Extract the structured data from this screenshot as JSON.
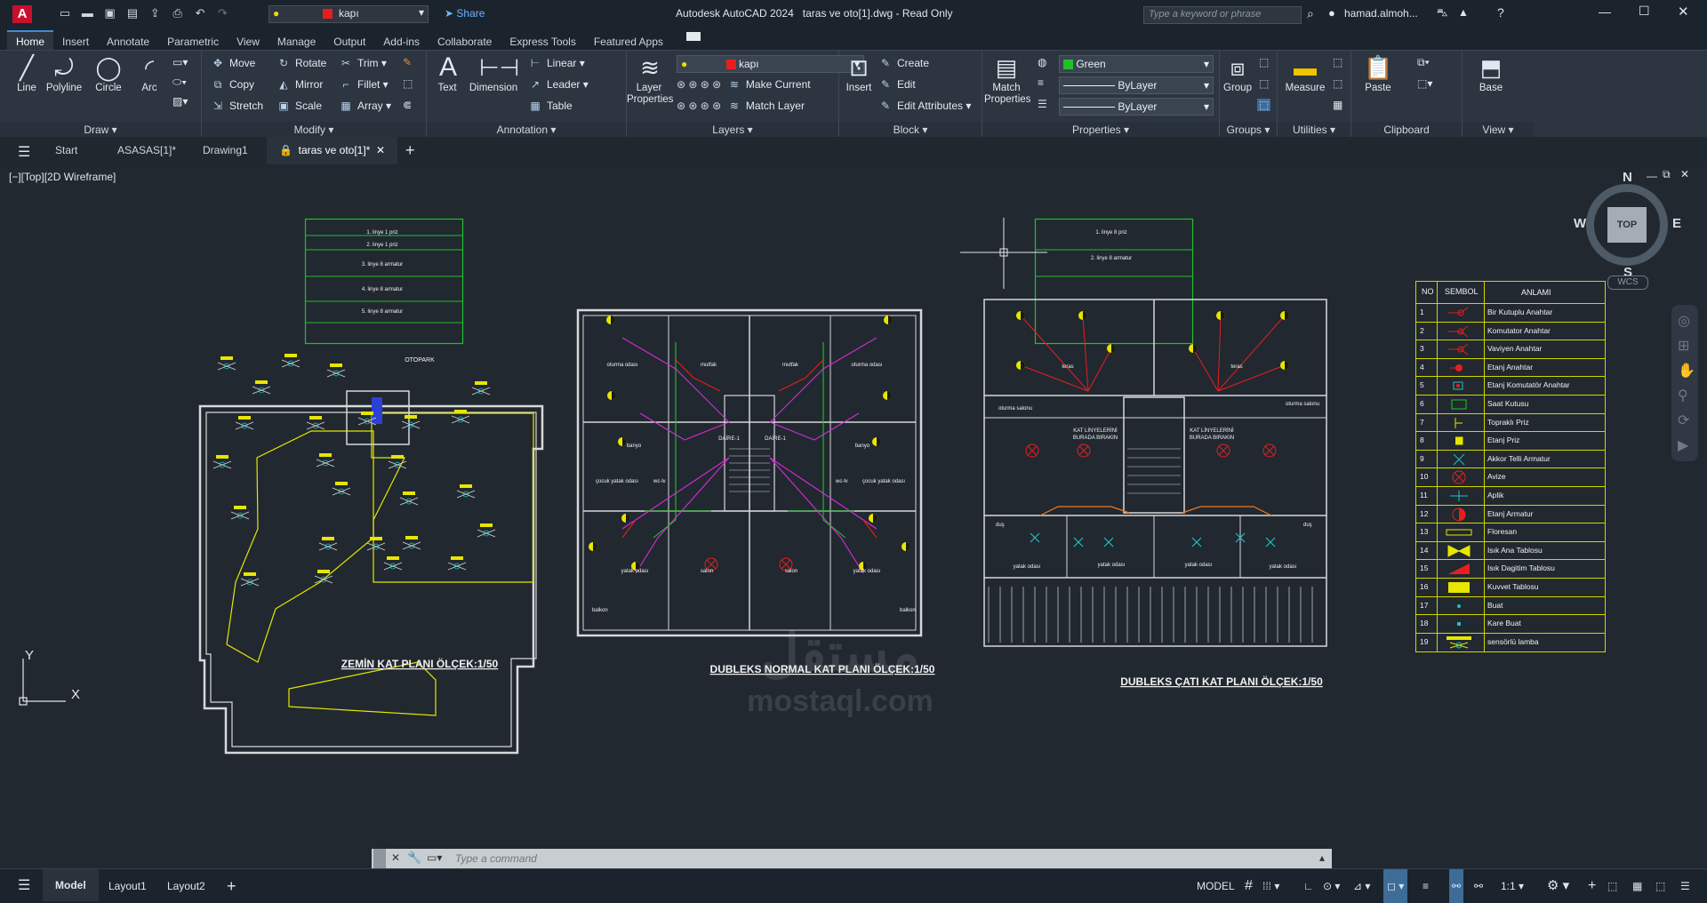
{
  "app": {
    "title": "Autodesk AutoCAD 2024",
    "file": "taras ve oto[1].dwg - Read Only",
    "share": "Share",
    "search_placeholder": "Type a keyword or phrase",
    "user": "hamad.almoh...",
    "layer_combo": "kapı"
  },
  "ribbon_tabs": [
    "Home",
    "Insert",
    "Annotate",
    "Parametric",
    "View",
    "Manage",
    "Output",
    "Add-ins",
    "Collaborate",
    "Express Tools",
    "Featured Apps"
  ],
  "ribbon": {
    "draw": {
      "title": "Draw",
      "line": "Line",
      "polyline": "Polyline",
      "circle": "Circle",
      "arc": "Arc"
    },
    "modify": {
      "title": "Modify",
      "move": "Move",
      "rotate": "Rotate",
      "trim": "Trim",
      "copy": "Copy",
      "mirror": "Mirror",
      "fillet": "Fillet",
      "stretch": "Stretch",
      "scale": "Scale",
      "array": "Array"
    },
    "annotation": {
      "title": "Annotation",
      "text": "Text",
      "dimension": "Dimension",
      "linear": "Linear",
      "leader": "Leader",
      "table": "Table"
    },
    "layers": {
      "title": "Layers",
      "layer_properties": "Layer Properties",
      "current_layer": "kapı",
      "make_current": "Make Current",
      "match_layer": "Match Layer"
    },
    "block": {
      "title": "Block",
      "insert": "Insert",
      "create": "Create",
      "edit": "Edit",
      "edit_attributes": "Edit Attributes"
    },
    "properties": {
      "title": "Properties",
      "match_properties": "Match Properties",
      "color": "Green",
      "linetype": "ByLayer",
      "lineweight": "ByLayer"
    },
    "groups": {
      "title": "Groups",
      "group": "Group"
    },
    "utilities": {
      "title": "Utilities",
      "measure": "Measure"
    },
    "clipboard": {
      "title": "Clipboard",
      "paste": "Paste"
    },
    "view": {
      "title": "View",
      "base": "Base"
    }
  },
  "doc_tabs": [
    "Start",
    "ASASAS[1]*",
    "Drawing1",
    "taras ve oto[1]*"
  ],
  "viewport_label": "[−][Top][2D Wireframe]",
  "viewcube": {
    "n": "N",
    "s": "S",
    "e": "E",
    "w": "W",
    "top": "TOP",
    "wcs": "WCS"
  },
  "ucs": {
    "x": "X",
    "y": "Y"
  },
  "command_placeholder": "Type a command",
  "status": {
    "layout_tabs": [
      "Model",
      "Layout1",
      "Layout2"
    ],
    "model": "MODEL",
    "scale": "1:1"
  },
  "drawing": {
    "note_table_1": [
      "1. linye 1 priz",
      "2. linye 1 priz",
      "3. linye 8 armatur",
      "4. linye 8 armatur",
      "5. linye 8 armatur"
    ],
    "note_table_2": [
      "1. linye 8 priz",
      "2. linye 8 armatur"
    ],
    "plan1_title": "ZEMİN KAT PLANI ÖLÇEK:1/50",
    "plan2_title": "DUBLEKS NORMAL KAT PLANI ÖLÇEK:1/50",
    "plan3_title": "DUBLEKS ÇATI KAT PLANI ÖLÇEK:1/50",
    "otopark": "OTOPARK",
    "room_labels": {
      "oturma": "oturma odası",
      "mutfak": "mutfak",
      "banyo": "banyo",
      "cocuk": "çocuk yatak odası",
      "yatak": "yatak odası",
      "salon": "salon",
      "balkon": "balkon",
      "daire1": "DAİRE-1",
      "wc": "wc-lv",
      "teras": "teras",
      "oturma_salonu": "oturma salonu",
      "kat_note_1": "KAT LİNYELERİNİ",
      "kat_note_2": "BURADA BIRAKIN",
      "dus": "duş"
    },
    "legend": {
      "headers": [
        "NO",
        "SEMBOL",
        "ANLAMI"
      ],
      "rows": [
        {
          "no": "1",
          "label": "Bir Kutuplu Anahtar",
          "sym": "switch"
        },
        {
          "no": "2",
          "label": "Komutator Anahtar",
          "sym": "switch2"
        },
        {
          "no": "3",
          "label": "Vaviyen Anahtar",
          "sym": "switch2"
        },
        {
          "no": "4",
          "label": "Etanj Anahtar",
          "sym": "switch3"
        },
        {
          "no": "5",
          "label": " Etanj  Komutatör Anahtar",
          "sym": "switch4"
        },
        {
          "no": "6",
          "label": "Saat Kutusu",
          "sym": "box"
        },
        {
          "no": "7",
          "label": "Topraklı Priz",
          "sym": "priz"
        },
        {
          "no": "8",
          "label": "Etanj Priz",
          "sym": "priz2"
        },
        {
          "no": "9",
          "label": "Akkor Telli Armatur",
          "sym": "x"
        },
        {
          "no": "10",
          "label": "Avize",
          "sym": "xcircle"
        },
        {
          "no": "11",
          "label": "Aplik",
          "sym": "aplik"
        },
        {
          "no": "12",
          "label": "Etanj Armatur",
          "sym": "halfcircle"
        },
        {
          "no": "13",
          "label": "Floresan",
          "sym": "floresan"
        },
        {
          "no": "14",
          "label": "Isık Ana Tablosu",
          "sym": "bowtie"
        },
        {
          "no": "15",
          "label": "Isık Dagitim Tablosu",
          "sym": "tri"
        },
        {
          "no": "16",
          "label": "Kuvvet Tablosu",
          "sym": "rect"
        },
        {
          "no": "17",
          "label": "Buat",
          "sym": "dot"
        },
        {
          "no": "18",
          "label": "Kare Buat",
          "sym": "sq"
        },
        {
          "no": "19",
          "label": "sensörlü lamba",
          "sym": "sensor"
        }
      ]
    }
  },
  "watermark": "مستقل\nmostaql.com",
  "colors": {
    "accent": "#3d8cd6",
    "layer_red": "#e81e1e",
    "green": "#22c02a",
    "yellow": "#e6e600"
  }
}
